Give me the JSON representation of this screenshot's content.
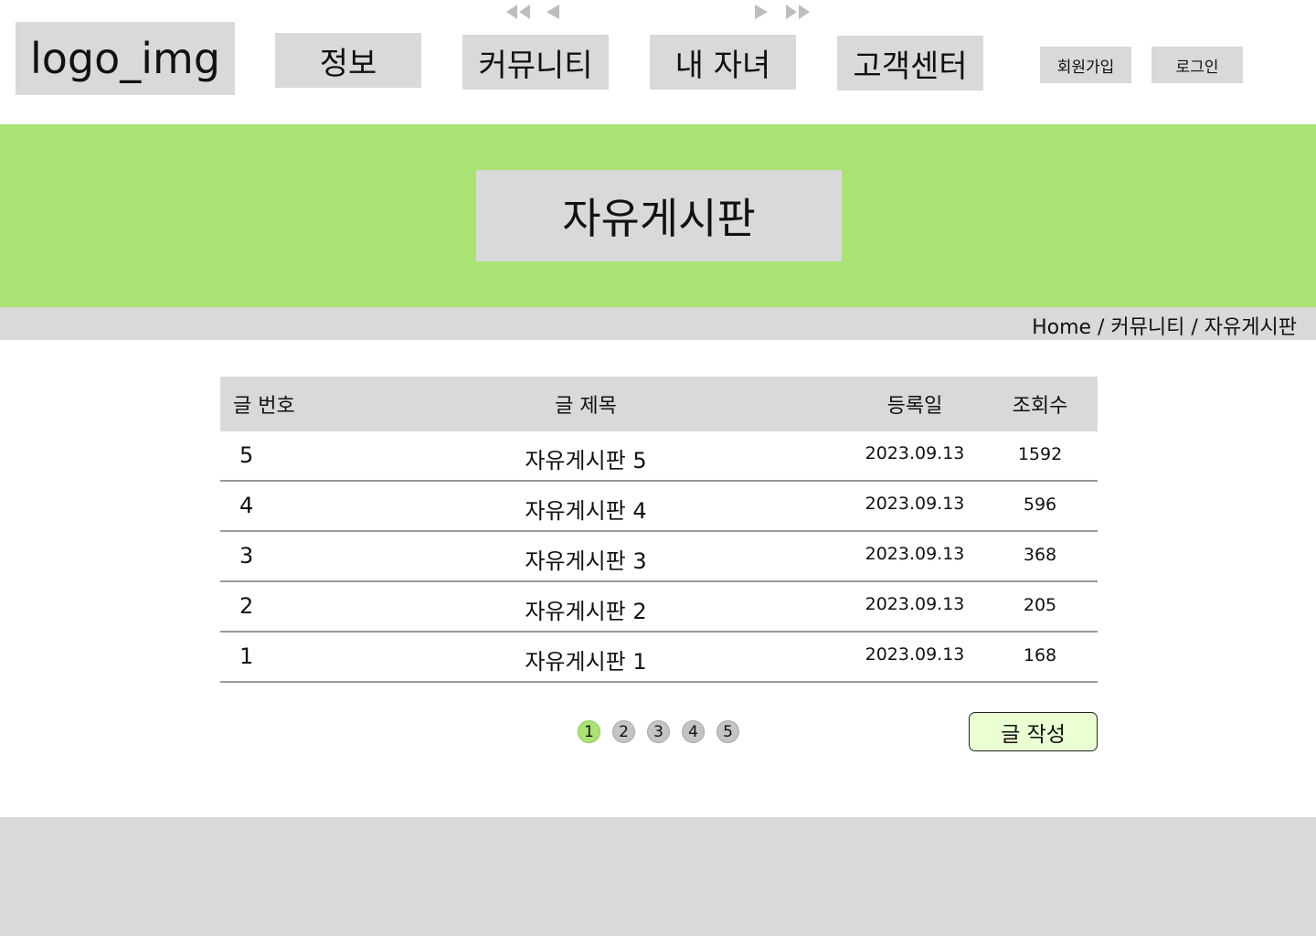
{
  "header": {
    "logo_text": "logo_img",
    "nav": [
      "정보",
      "커뮤니티",
      "내 자녀",
      "고객센터"
    ],
    "signup_label": "회원가입",
    "login_label": "로그인"
  },
  "hero": {
    "title": "자유게시판"
  },
  "breadcrumb": {
    "text": "Home / 커뮤니티 / 자유게시판"
  },
  "board": {
    "columns": [
      "글 번호",
      "글 제목",
      "등록일",
      "조회수"
    ],
    "rows": [
      {
        "no": "5",
        "title": "자유게시판 5",
        "date": "2023.09.13",
        "views": "1592"
      },
      {
        "no": "4",
        "title": "자유게시판 4",
        "date": "2023.09.13",
        "views": "596"
      },
      {
        "no": "3",
        "title": "자유게시판 3",
        "date": "2023.09.13",
        "views": "368"
      },
      {
        "no": "2",
        "title": "자유게시판 2",
        "date": "2023.09.13",
        "views": "205"
      },
      {
        "no": "1",
        "title": "자유게시판 1",
        "date": "2023.09.13",
        "views": "168"
      }
    ]
  },
  "pagination": {
    "pages": [
      "1",
      "2",
      "3",
      "4",
      "5"
    ],
    "current": "1",
    "icons": [
      "first-page-icon",
      "prev-page-icon",
      "next-page-icon",
      "last-page-icon"
    ],
    "active_color": "#aae374",
    "inactive_color": "#c4c4c4"
  },
  "write_button": {
    "label": "글 작성"
  },
  "colors": {
    "hero_bg": "#aae374",
    "box_bg": "#d9d9d9",
    "write_btn_bg": "#eaffd2"
  }
}
